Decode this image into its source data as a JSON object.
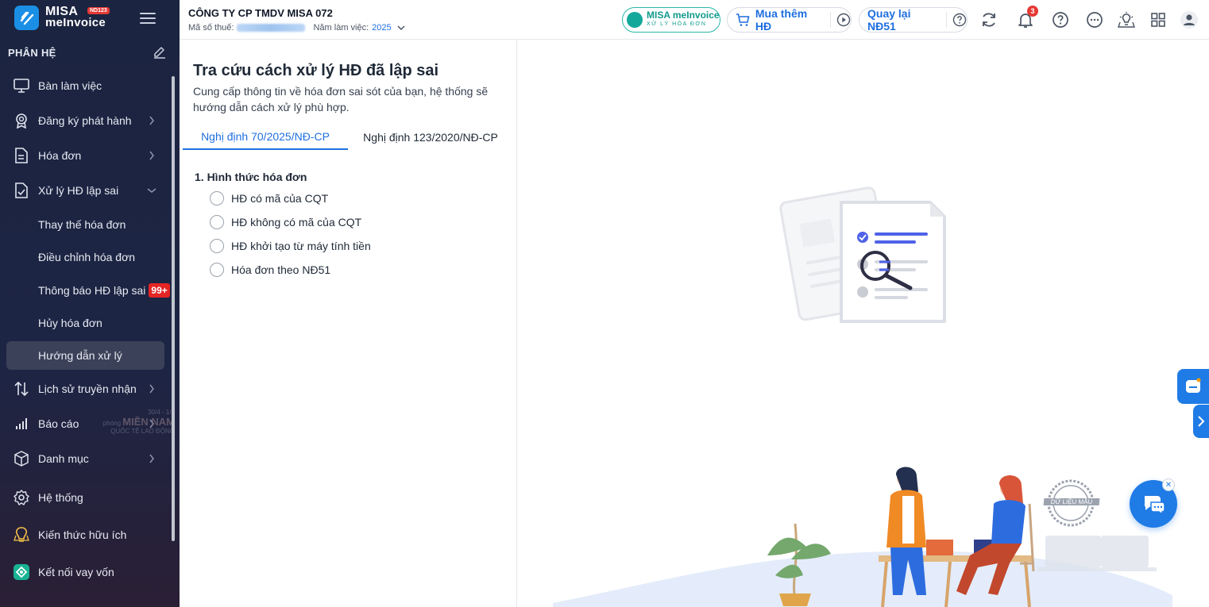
{
  "brand": {
    "name_line1": "MISA",
    "name_line2": "meInvoice",
    "badge": "ND123"
  },
  "sidebar": {
    "section_title": "PHÂN HỆ",
    "items": [
      {
        "label": "Bàn làm việc",
        "icon": "monitor-icon"
      },
      {
        "label": "Đăng ký phát hành",
        "icon": "award-icon"
      },
      {
        "label": "Hóa đơn",
        "icon": "document-icon"
      },
      {
        "label": "Xử lý HĐ lập sai",
        "icon": "check-document-icon"
      },
      {
        "label": "Lịch sử truyền nhận",
        "icon": "transfer-icon"
      },
      {
        "label": "Báo cáo",
        "icon": "bar-chart-icon"
      },
      {
        "label": "Danh mục",
        "icon": "box-icon"
      },
      {
        "label": "Hệ thống",
        "icon": "gear-icon"
      },
      {
        "label": "Kiến thức hữu ích",
        "icon": "lightbulb-icon"
      },
      {
        "label": "Kết nối vay vốn",
        "icon": "loan-icon"
      }
    ],
    "sub_items": [
      {
        "label": "Thay thế hóa đơn"
      },
      {
        "label": "Điều chỉnh hóa đơn"
      },
      {
        "label": "Thông báo HĐ lập sai",
        "badge": "99+"
      },
      {
        "label": "Hủy hóa đơn"
      },
      {
        "label": "Hướng dẫn xử lý"
      }
    ],
    "promo": {
      "date": "30/4 - 1/5",
      "line1": "MIỀN NAM",
      "line2": "QUỐC TẾ LAO ĐỘNG",
      "prefix": "phóng"
    }
  },
  "header": {
    "company": "CÔNG TY CP TMDV MISA 072",
    "tax_label": "Mã số thuế:",
    "year_label": "Năm làm việc:",
    "year_value": "2025",
    "misa_pill": {
      "line1": "MISA meInvoice",
      "line2": "XỬ LÝ HÓA ĐƠN"
    },
    "buy_label": "Mua thêm HĐ",
    "back_label": "Quay lại NĐ51",
    "notification_count": "3"
  },
  "panel": {
    "title": "Tra cứu cách xử lý HĐ đã lập sai",
    "description": "Cung cấp thông tin về hóa đơn sai sót của bạn, hệ thống sẽ hướng dẫn cách xử lý phù hợp.",
    "tabs": [
      {
        "label": "Nghị định 70/2025/NĐ-CP",
        "active": true
      },
      {
        "label": "Nghị định 123/2020/NĐ-CP",
        "active": false
      }
    ],
    "group_title": "1. Hình thức hóa đơn",
    "options": [
      {
        "label": "HĐ có mã của CQT"
      },
      {
        "label": "HĐ không có mã của CQT"
      },
      {
        "label": "HĐ khởi tạo từ máy tính tiền"
      },
      {
        "label": "Hóa đơn theo NĐ51"
      }
    ]
  },
  "main": {
    "stamp_label": "DỮ LIỆU MẪU"
  },
  "colors": {
    "accent": "#1f6fe0",
    "sidebar_bg": "#1b2440",
    "badge_red": "#e52424",
    "teal": "#14a89b"
  }
}
